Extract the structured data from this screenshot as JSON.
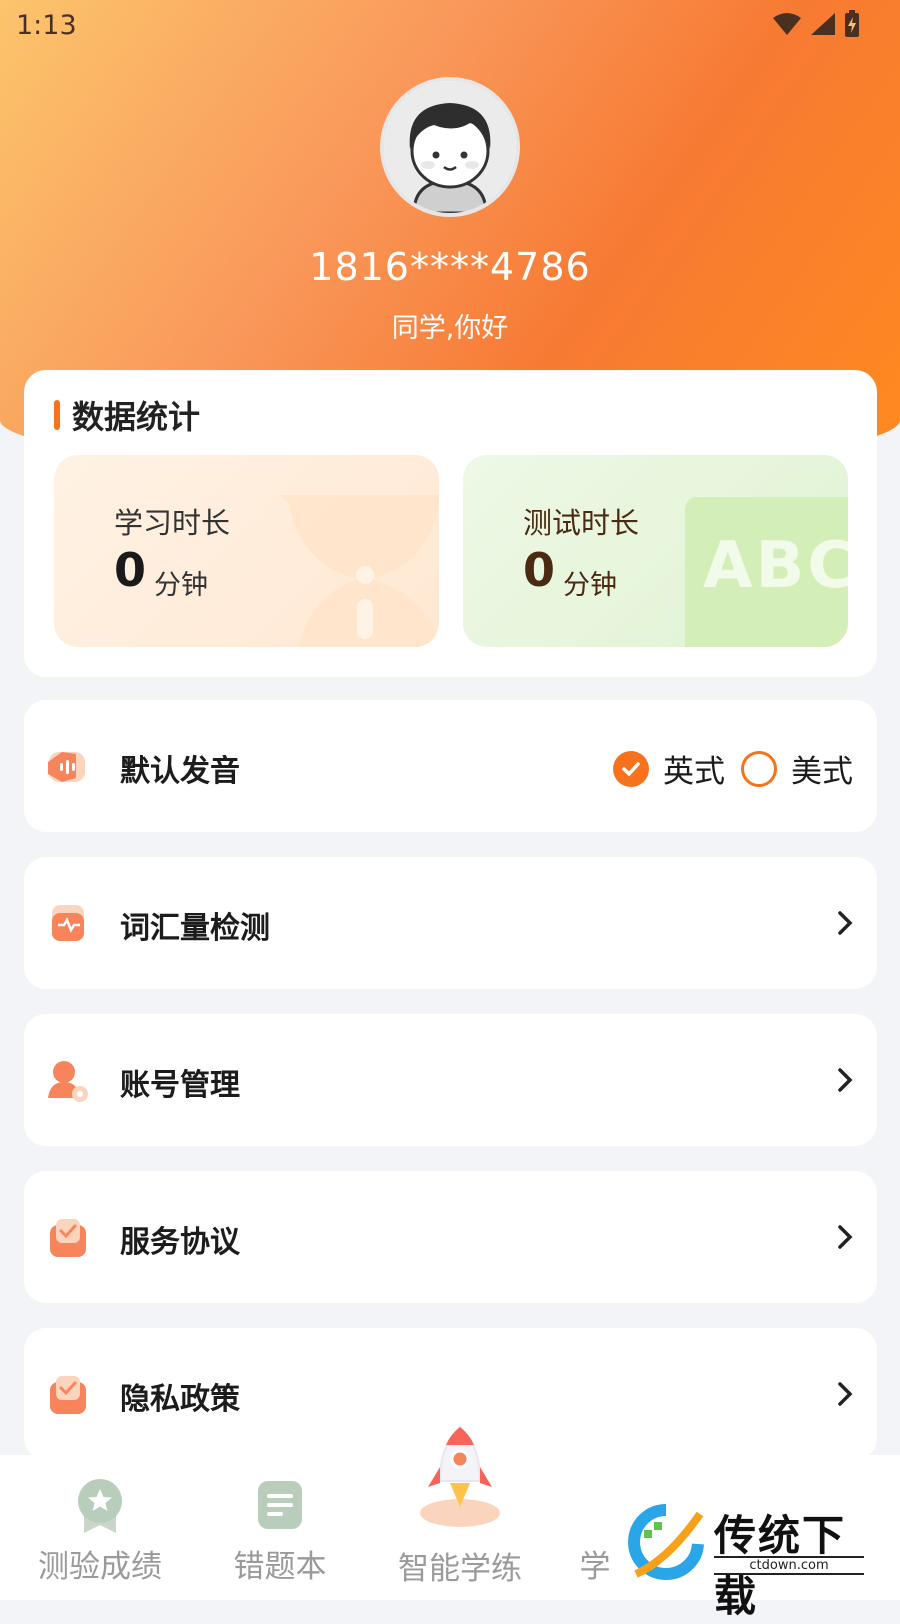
{
  "status": {
    "time": "1:13"
  },
  "profile": {
    "phone": "1816****4786",
    "greeting": "同学,你好"
  },
  "stats": {
    "title": "数据统计",
    "study": {
      "label": "学习时长",
      "value": "0",
      "unit": "分钟"
    },
    "test": {
      "label": "测试时长",
      "value": "0",
      "unit": "分钟",
      "deco_text": "ABC"
    }
  },
  "pronunciation": {
    "label": "默认发音",
    "options": [
      {
        "label": "英式",
        "selected": true
      },
      {
        "label": "美式",
        "selected": false
      }
    ]
  },
  "menu": [
    {
      "label": "词汇量检测"
    },
    {
      "label": "账号管理"
    },
    {
      "label": "服务协议"
    },
    {
      "label": "隐私政策"
    }
  ],
  "tabs": [
    {
      "label": "测验成绩"
    },
    {
      "label": "错题本"
    },
    {
      "label": "智能学练"
    },
    {
      "label": "学"
    }
  ],
  "watermark": {
    "text": "传统下载",
    "sub": "ctdown.com"
  },
  "colors": {
    "accent": "#f7721c",
    "hero_start": "#fcc46c",
    "hero_end": "#ff8a1f"
  }
}
